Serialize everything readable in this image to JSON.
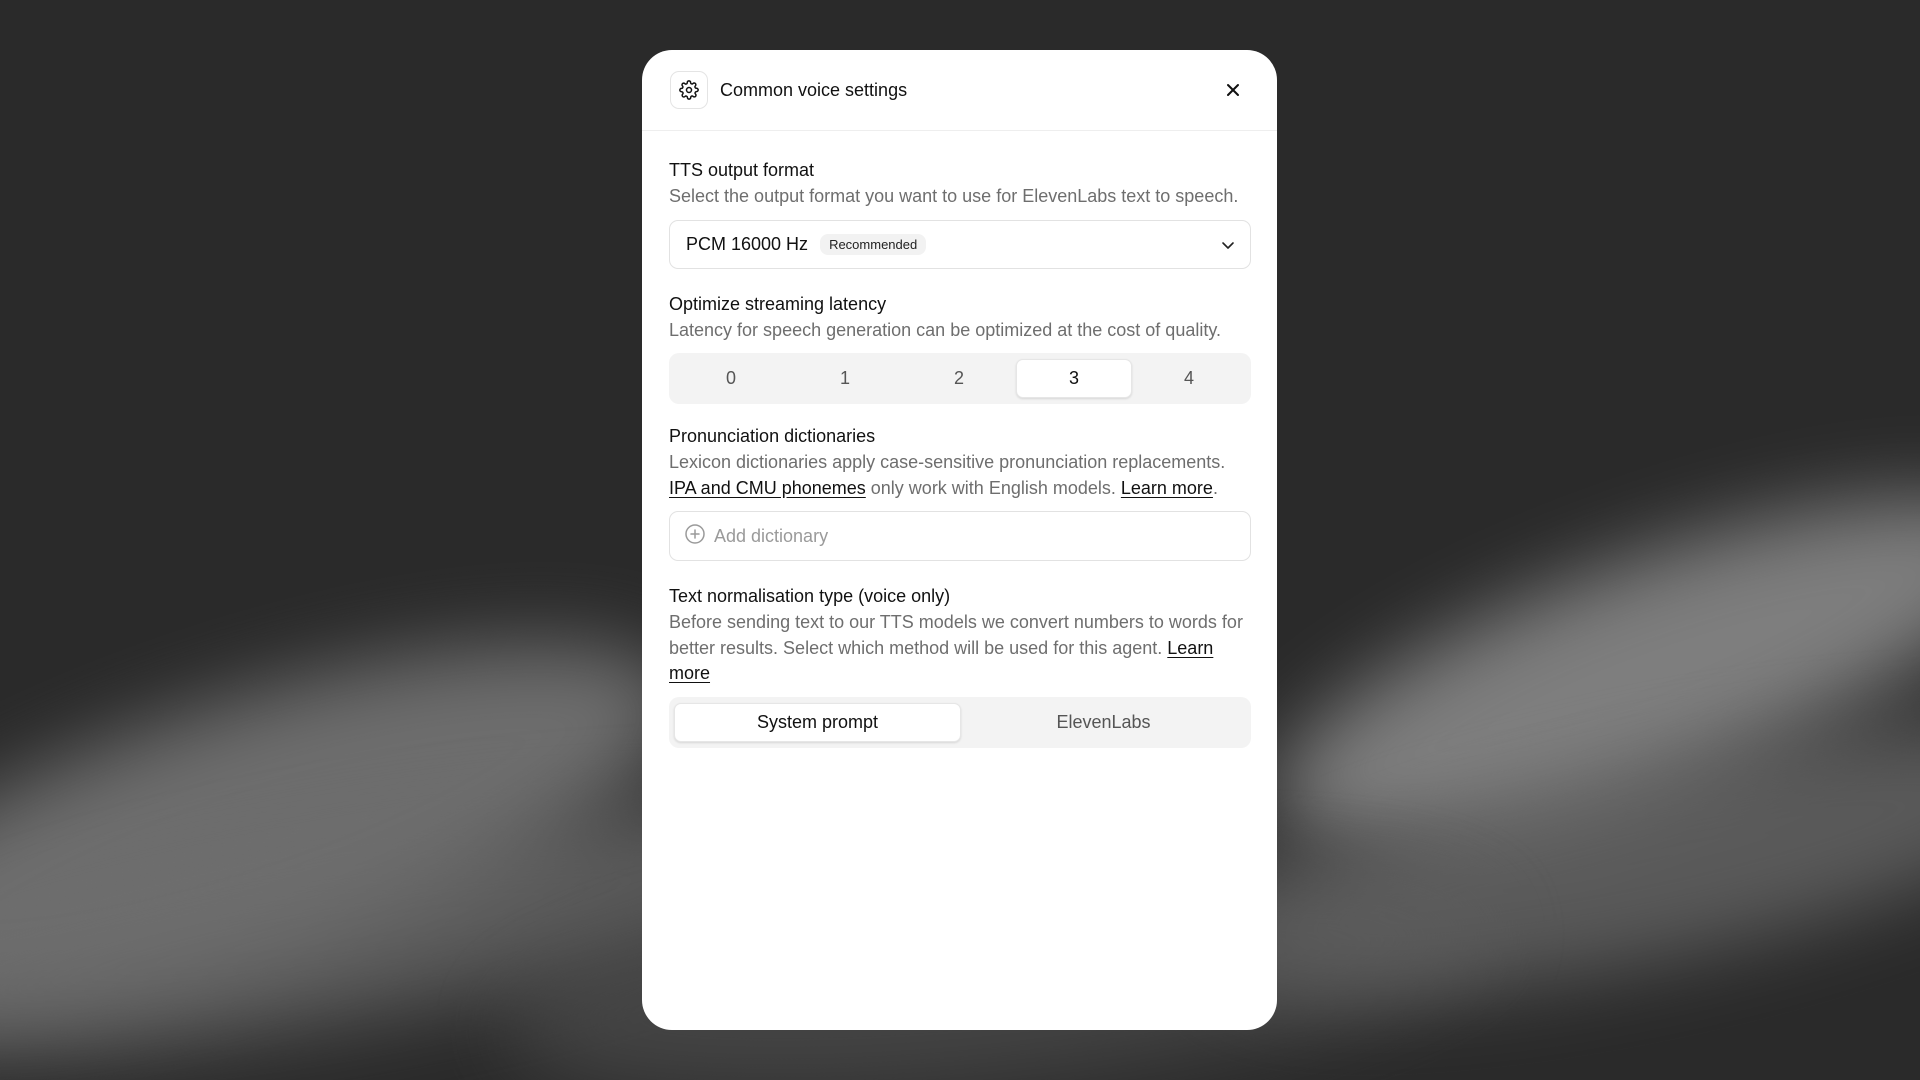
{
  "colors": {
    "background": "#2a2a2a",
    "panel": "#ffffff",
    "muted_text": "#6e6e6e",
    "primary_text": "#111111"
  },
  "header": {
    "title": "Common voice settings",
    "icon": "gear-icon",
    "close_icon": "close-icon"
  },
  "tts_format": {
    "title": "TTS output format",
    "description": "Select the output format you want to use for ElevenLabs text to speech.",
    "selected": "PCM 16000 Hz",
    "badge": "Recommended"
  },
  "latency": {
    "title": "Optimize streaming latency",
    "description": "Latency for speech generation can be optimized at the cost of quality.",
    "options": [
      "0",
      "1",
      "2",
      "3",
      "4"
    ],
    "selected": "3"
  },
  "dictionaries": {
    "title": "Pronunciation dictionaries",
    "desc_part1": "Lexicon dictionaries apply case-sensitive pronunciation replacements. ",
    "desc_link1": "IPA and CMU phonemes",
    "desc_part2": " only work with English models. ",
    "desc_link2": "Learn more",
    "desc_part3": ".",
    "add_label": "Add dictionary"
  },
  "normalisation": {
    "title": "Text normalisation type (voice only)",
    "desc_text": "Before sending text to our TTS models we convert numbers to words for better results. Select which method will be used for this agent.",
    "desc_link": "Learn more",
    "options": [
      "System prompt",
      "ElevenLabs"
    ],
    "selected": "System prompt"
  }
}
